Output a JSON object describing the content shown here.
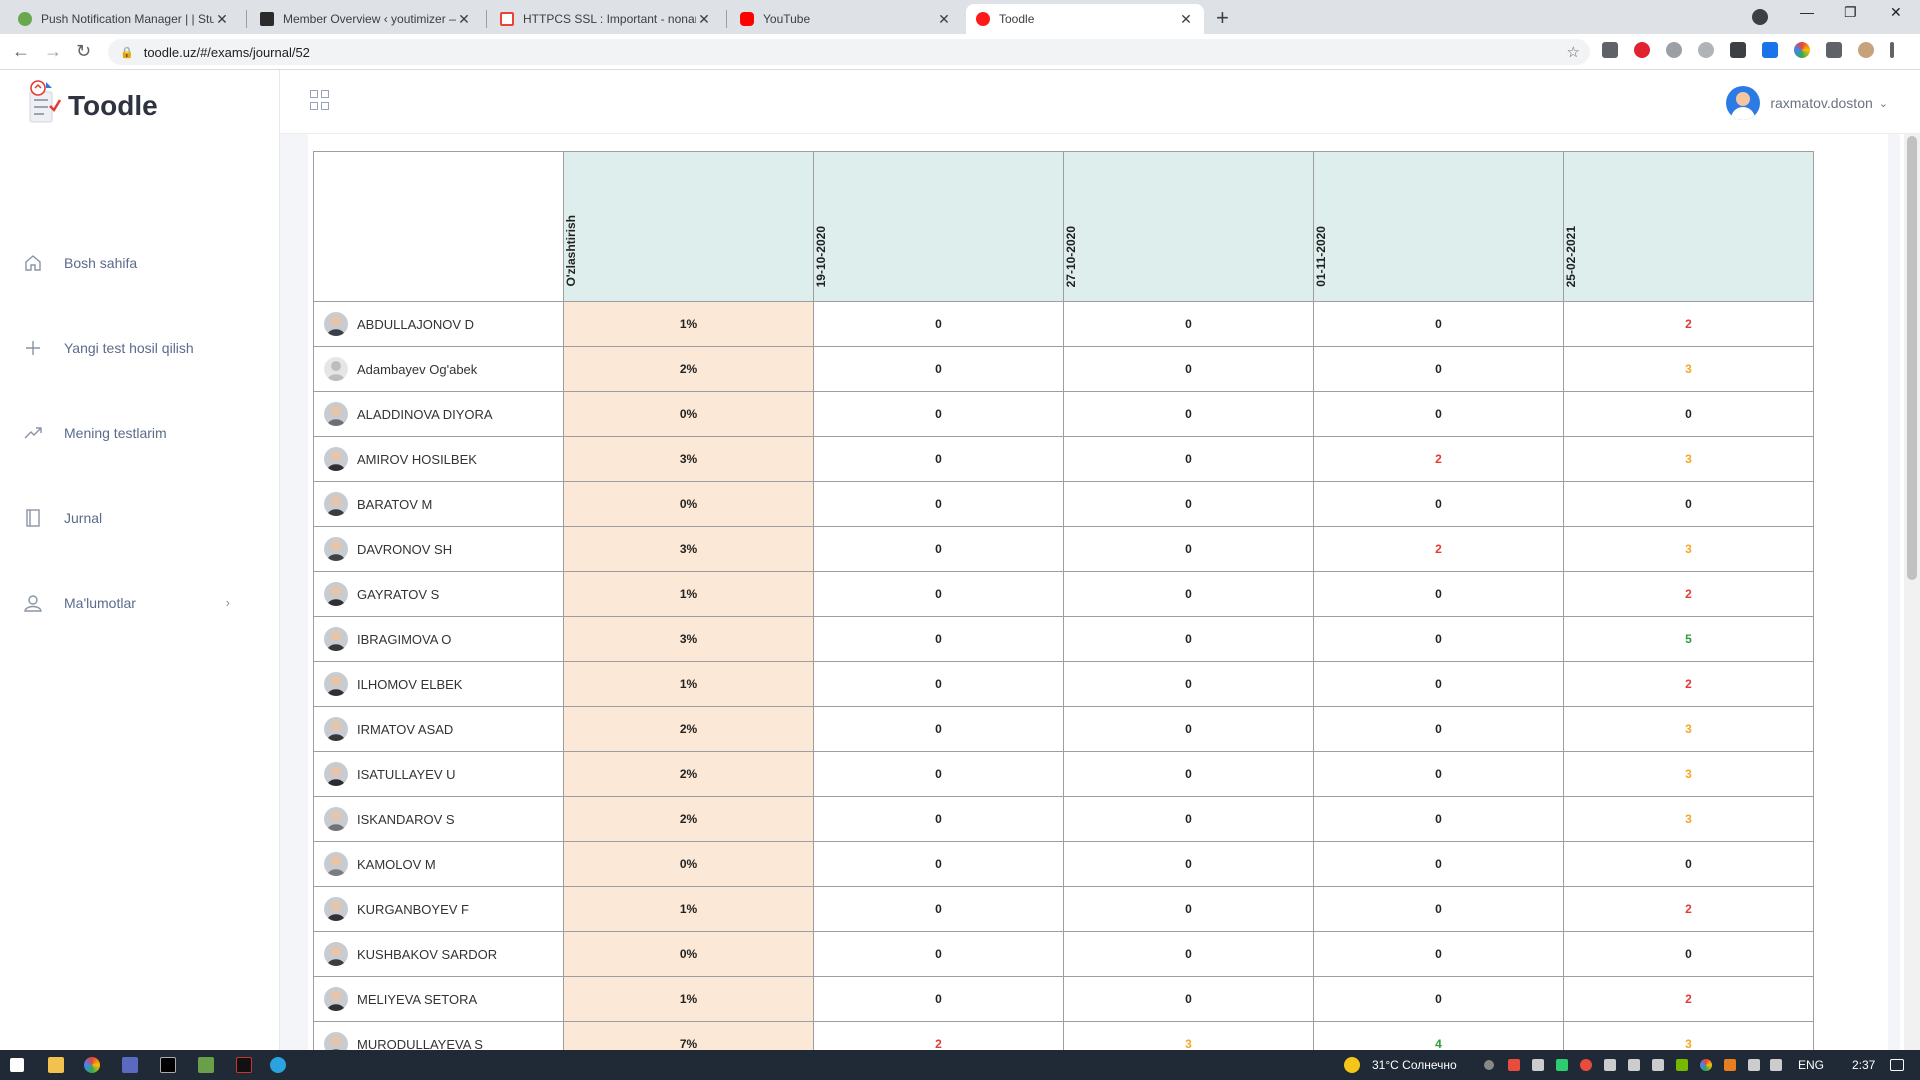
{
  "browser": {
    "tabs": [
      {
        "title": "Push Notification Manager | | Stu",
        "color": "#6aa84f"
      },
      {
        "title": "Member Overview ‹ youtimizer —",
        "color": "#c0392b"
      },
      {
        "title": "HTTPCS SSL : Important - nonam",
        "color": "#ea4335"
      },
      {
        "title": "YouTube",
        "color": "#ff0000"
      },
      {
        "title": "Toodle",
        "color": "#ff1a1a"
      }
    ],
    "url": "toodle.uz/#/exams/journal/52"
  },
  "app": {
    "logo_text": "Toodle",
    "username": "raxmatov.doston",
    "menu": [
      {
        "label": "Bosh sahifa",
        "icon": "home-icon"
      },
      {
        "label": "Yangi test hosil qilish",
        "icon": "plus-icon"
      },
      {
        "label": "Mening testlarim",
        "icon": "chart-trend-icon"
      },
      {
        "label": "Jurnal",
        "icon": "book-icon"
      },
      {
        "label": "Ma'lumotlar",
        "icon": "user-icon"
      }
    ]
  },
  "journal": {
    "columns": [
      "O'zlashtirish",
      "19-10-2020",
      "27-10-2020",
      "01-11-2020",
      "25-02-2021"
    ],
    "rows": [
      {
        "name": "ABDULLAJONOV D",
        "pct": "1%",
        "scores": [
          "0",
          "0",
          "0",
          "2"
        ]
      },
      {
        "name": "Adambayev Og'abek",
        "pct": "2%",
        "scores": [
          "0",
          "0",
          "0",
          "3"
        ]
      },
      {
        "name": "ALADDINOVA DIYORA",
        "pct": "0%",
        "scores": [
          "0",
          "0",
          "0",
          "0"
        ]
      },
      {
        "name": "AMIROV HOSILBEK",
        "pct": "3%",
        "scores": [
          "0",
          "0",
          "2",
          "3"
        ]
      },
      {
        "name": "BARATOV M",
        "pct": "0%",
        "scores": [
          "0",
          "0",
          "0",
          "0"
        ]
      },
      {
        "name": "DAVRONOV SH",
        "pct": "3%",
        "scores": [
          "0",
          "0",
          "2",
          "3"
        ]
      },
      {
        "name": "GAYRATOV S",
        "pct": "1%",
        "scores": [
          "0",
          "0",
          "0",
          "2"
        ]
      },
      {
        "name": "IBRAGIMOVA O",
        "pct": "3%",
        "scores": [
          "0",
          "0",
          "0",
          "5"
        ]
      },
      {
        "name": "ILHOMOV ELBEK",
        "pct": "1%",
        "scores": [
          "0",
          "0",
          "0",
          "2"
        ]
      },
      {
        "name": "IRMATOV ASAD",
        "pct": "2%",
        "scores": [
          "0",
          "0",
          "0",
          "3"
        ]
      },
      {
        "name": "ISATULLAYEV U",
        "pct": "2%",
        "scores": [
          "0",
          "0",
          "0",
          "3"
        ]
      },
      {
        "name": "ISKANDAROV S",
        "pct": "2%",
        "scores": [
          "0",
          "0",
          "0",
          "3"
        ]
      },
      {
        "name": "KAMOLOV M",
        "pct": "0%",
        "scores": [
          "0",
          "0",
          "0",
          "0"
        ]
      },
      {
        "name": "KURGANBOYEV F",
        "pct": "1%",
        "scores": [
          "0",
          "0",
          "0",
          "2"
        ]
      },
      {
        "name": "KUSHBAKOV SARDOR",
        "pct": "0%",
        "scores": [
          "0",
          "0",
          "0",
          "0"
        ]
      },
      {
        "name": "MELIYEVA SETORA",
        "pct": "1%",
        "scores": [
          "0",
          "0",
          "0",
          "2"
        ]
      },
      {
        "name": "MURODULLAYEVA S",
        "pct": "7%",
        "scores": [
          "2",
          "3",
          "4",
          "3"
        ]
      }
    ],
    "score_colors": {
      "0": "#222222",
      "2": "#e53935",
      "3": "#f5a623",
      "4": "#2e9e3a",
      "5": "#2e9e3a"
    }
  },
  "taskbar": {
    "weather": "31°C  Солнечно",
    "lang": "ENG",
    "time": "2:37"
  }
}
